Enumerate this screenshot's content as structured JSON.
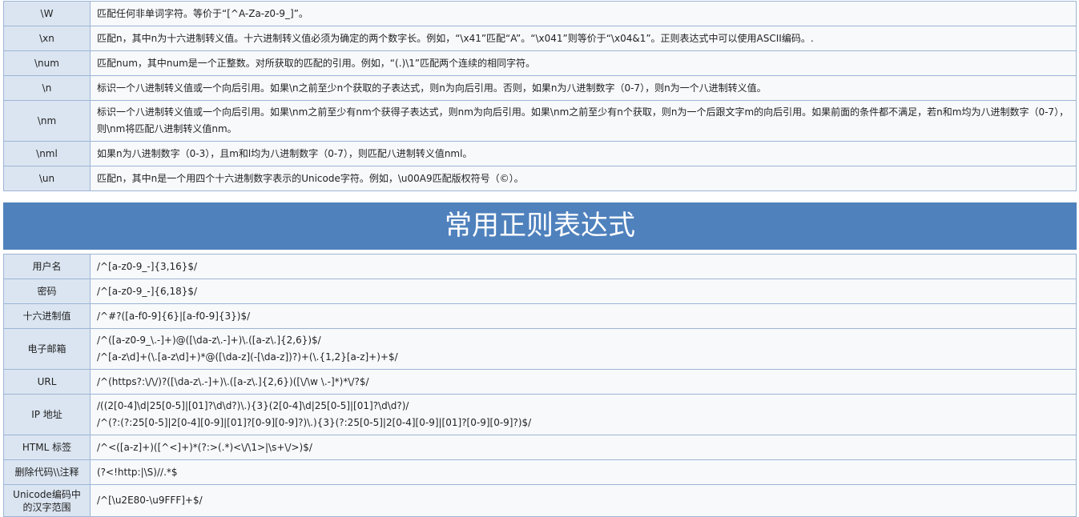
{
  "metachars": [
    {
      "key": "\\W",
      "desc": "匹配任何非单词字符。等价于“[^A-Za-z0-9_]”。"
    },
    {
      "key": "\\xn",
      "desc": "匹配n，其中n为十六进制转义值。十六进制转义值必须为确定的两个数字长。例如，“\\x41”匹配“A”。“\\x041”则等价于“\\x04&1”。正则表达式中可以使用ASCII编码。."
    },
    {
      "key": "\\num",
      "desc": "匹配num，其中num是一个正整数。对所获取的匹配的引用。例如，“(.)\\1”匹配两个连续的相同字符。"
    },
    {
      "key": "\\n",
      "desc": "标识一个八进制转义值或一个向后引用。如果\\n之前至少n个获取的子表达式，则n为向后引用。否则，如果n为八进制数字（0-7），则n为一个八进制转义值。"
    },
    {
      "key": "\\nm",
      "desc": "标识一个八进制转义值或一个向后引用。如果\\nm之前至少有nm个获得子表达式，则nm为向后引用。如果\\nm之前至少有n个获取，则n为一个后跟文字m的向后引用。如果前面的条件都不满足，若n和m均为八进制数字（0-7），则\\nm将匹配八进制转义值nm。"
    },
    {
      "key": "\\nml",
      "desc": "如果n为八进制数字（0-3），且m和l均为八进制数字（0-7），则匹配八进制转义值nml。"
    },
    {
      "key": "\\un",
      "desc": "匹配n，其中n是一个用四个十六进制数字表示的Unicode字符。例如，\\u00A9匹配版权符号（©）。"
    }
  ],
  "section_title": "常用正则表达式",
  "common": [
    {
      "key": "用户名",
      "lines": [
        "/^[a-z0-9_-]{3,16}$/"
      ]
    },
    {
      "key": "密码",
      "lines": [
        "/^[a-z0-9_-]{6,18}$/"
      ]
    },
    {
      "key": "十六进制值",
      "lines": [
        "/^#?([a-f0-9]{6}|[a-f0-9]{3})$/"
      ]
    },
    {
      "key": "电子邮箱",
      "lines": [
        "/^([a-z0-9_\\.-]+)@([\\da-z\\.-]+)\\.([a-z\\.]{2,6})$/",
        "/^[a-z\\d]+(\\.[a-z\\d]+)*@([\\da-z](-[\\da-z])?)+(\\.{1,2}[a-z]+)+$/"
      ]
    },
    {
      "key": "URL",
      "lines": [
        "/^(https?:\\/\\/)?([\\da-z\\.-]+)\\.([a-z\\.]{2,6})([\\/\\w \\.-]*)*\\/?$/"
      ]
    },
    {
      "key": "IP 地址",
      "lines": [
        "/((2[0-4]\\d|25[0-5]|[01]?\\d\\d?)\\.){3}(2[0-4]\\d|25[0-5]|[01]?\\d\\d?)/",
        "/^(?:(?:25[0-5]|2[0-4][0-9]|[01]?[0-9][0-9]?)\\.){3}(?:25[0-5]|2[0-4][0-9]|[01]?[0-9][0-9]?)$/"
      ]
    },
    {
      "key": "HTML 标签",
      "lines": [
        "/^<([a-z]+)([^<]+)*(?:>(.*)<\\/\\1>|\\s+\\/>)$/"
      ]
    },
    {
      "key": "删除代码\\\\注释",
      "lines": [
        "(?<!http:|\\S)//.*$"
      ]
    },
    {
      "key": "Unicode编码中的汉字范围",
      "lines": [
        "/^[\\u2E80-\\u9FFF]+$/"
      ]
    }
  ]
}
